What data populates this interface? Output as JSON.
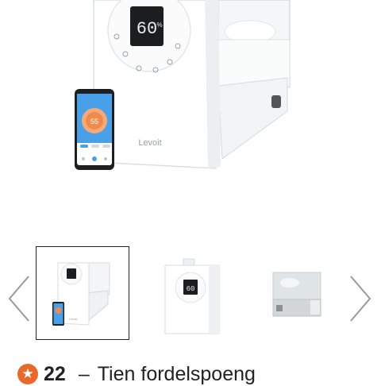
{
  "product": {
    "brand": "Levoit",
    "display_reading": "60",
    "display_unit": "%",
    "app_reading": "55"
  },
  "gallery": {
    "thumbnail_count": 3,
    "selected_index": 0,
    "thumb2_reading": "60"
  },
  "rewards": {
    "icon": "star-coin-icon",
    "points": "22",
    "dash": "–",
    "label": "Tien fordelspoeng"
  },
  "colors": {
    "accent": "#e8692c",
    "phone_screen": "#4aa0e8",
    "text": "#222222"
  }
}
